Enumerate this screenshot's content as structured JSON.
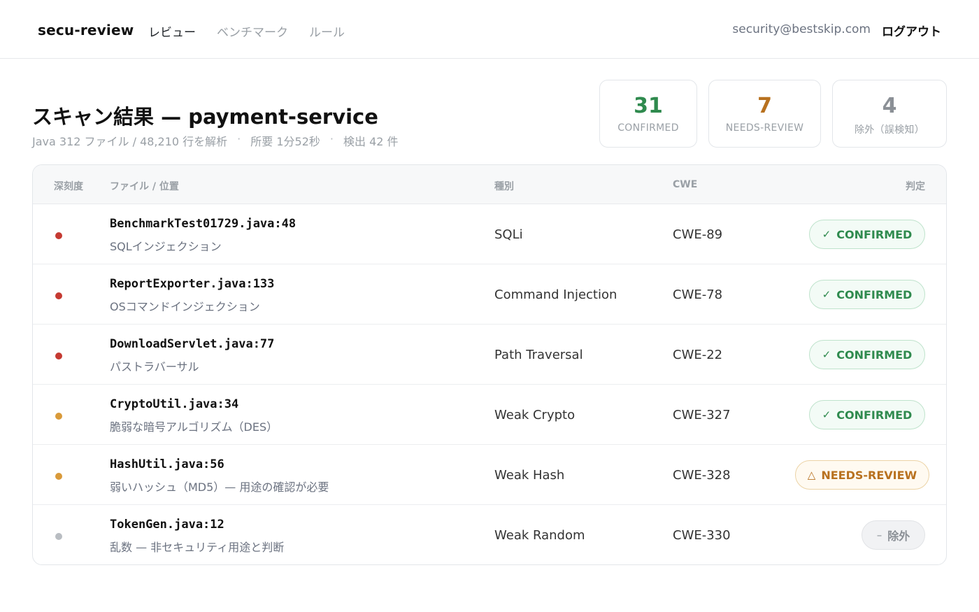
{
  "header": {
    "brand": "secu-review",
    "nav": [
      {
        "label": "レビュー",
        "active": true
      },
      {
        "label": "ベンチマーク",
        "active": false
      },
      {
        "label": "ルール",
        "active": false
      }
    ],
    "user_email": "security@bestskip.com",
    "logout_label": "ログアウト"
  },
  "scan": {
    "title": "スキャン結果 — payment-service",
    "meta": [
      "Java 312 ファイル / 48,210 行を解析",
      "所要 1分52秒",
      "検出 42 件"
    ],
    "meta_separator": "·"
  },
  "stats": [
    {
      "value": "31",
      "label": "CONFIRMED",
      "color": "#2f8a4e"
    },
    {
      "value": "7",
      "label": "NEEDS-REVIEW",
      "color": "#b8711f"
    },
    {
      "value": "4",
      "label": "除外（誤検知）",
      "color": "#8b9096"
    }
  ],
  "table": {
    "columns": {
      "severity": "深刻度",
      "file": "ファイル / 位置",
      "type": "種別",
      "cwe": "CWE",
      "verdict": "判定"
    },
    "rows": [
      {
        "severity_color": "#c53a32",
        "file": "BenchmarkTest01729.java:48",
        "desc": "SQLインジェクション",
        "type": "SQLi",
        "cwe": "CWE-89",
        "verdict": "CONFIRMED",
        "verdict_icon": "✓",
        "verdict_kind": "confirmed"
      },
      {
        "severity_color": "#c53a32",
        "file": "ReportExporter.java:133",
        "desc": "OSコマンドインジェクション",
        "type": "Command Injection",
        "cwe": "CWE-78",
        "verdict": "CONFIRMED",
        "verdict_icon": "✓",
        "verdict_kind": "confirmed"
      },
      {
        "severity_color": "#c53a32",
        "file": "DownloadServlet.java:77",
        "desc": "パストラバーサル",
        "type": "Path Traversal",
        "cwe": "CWE-22",
        "verdict": "CONFIRMED",
        "verdict_icon": "✓",
        "verdict_kind": "confirmed"
      },
      {
        "severity_color": "#d99a3a",
        "file": "CryptoUtil.java:34",
        "desc": "脆弱な暗号アルゴリズム（DES）",
        "type": "Weak Crypto",
        "cwe": "CWE-327",
        "verdict": "CONFIRMED",
        "verdict_icon": "✓",
        "verdict_kind": "confirmed"
      },
      {
        "severity_color": "#d99a3a",
        "file": "HashUtil.java:56",
        "desc": "弱いハッシュ（MD5）— 用途の確認が必要",
        "type": "Weak Hash",
        "cwe": "CWE-328",
        "verdict": "NEEDS-REVIEW",
        "verdict_icon": "△",
        "verdict_kind": "review"
      },
      {
        "severity_color": "#b9bdc2",
        "file": "TokenGen.java:12",
        "desc": "乱数 — 非セキュリティ用途と判断",
        "type": "Weak Random",
        "cwe": "CWE-330",
        "verdict": "除外",
        "verdict_icon": "–",
        "verdict_kind": "excluded"
      }
    ]
  }
}
